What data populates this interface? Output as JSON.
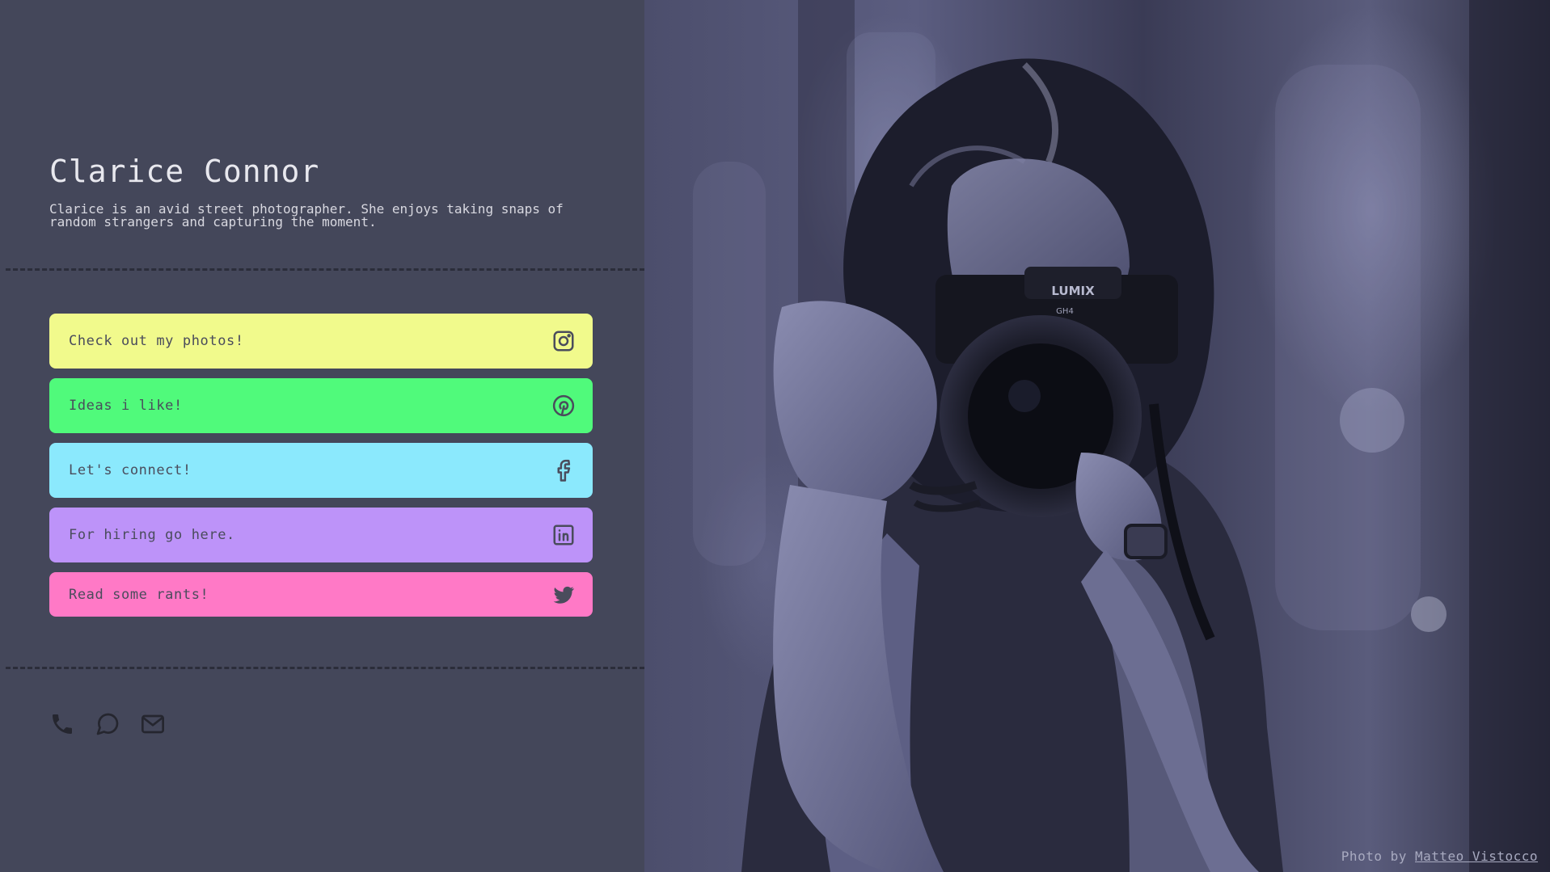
{
  "profile": {
    "name": "Clarice Connor",
    "bio": "Clarice is an avid street photographer. She enjoys taking snaps of random strangers and capturing the moment."
  },
  "links": [
    {
      "label": "Check out my photos!",
      "icon": "instagram-icon",
      "color": "#f1fa8c"
    },
    {
      "label": "Ideas i like!",
      "icon": "pinterest-icon",
      "color": "#50fa7b"
    },
    {
      "label": "Let's connect!",
      "icon": "facebook-icon",
      "color": "#8be9fd"
    },
    {
      "label": "For hiring go here.",
      "icon": "linkedin-icon",
      "color": "#bd93f9"
    },
    {
      "label": "Read some rants!",
      "icon": "twitter-icon",
      "color": "#ff79c6"
    }
  ],
  "contacts": [
    {
      "icon": "phone-icon"
    },
    {
      "icon": "chat-bubble-icon"
    },
    {
      "icon": "mail-icon"
    }
  ],
  "photo": {
    "camera_brand": "LUMIX",
    "camera_model": "GH4",
    "credit_prefix": "Photo by",
    "credit_author": "Matteo Vistocco"
  },
  "colors": {
    "background": "#44475a",
    "divider": "#2b2d3a",
    "icon": "#4a4c5c"
  }
}
